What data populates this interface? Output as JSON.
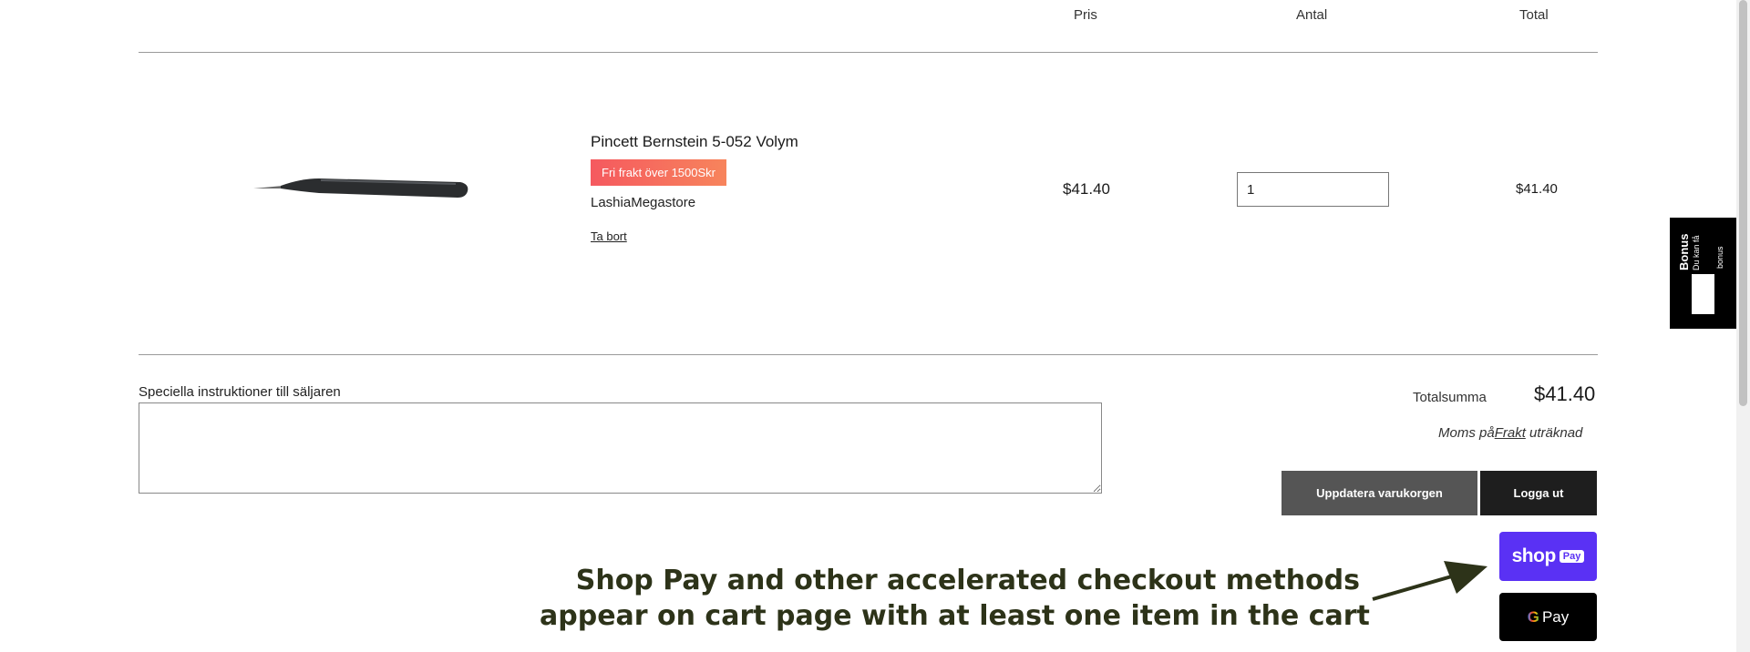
{
  "table_headers": {
    "price": "Pris",
    "quantity": "Antal",
    "total": "Total"
  },
  "item": {
    "title": "Pincett Bernstein 5-052 Volym",
    "promo_badge": "Fri frakt över 1500Skr",
    "vendor": "LashiaMegastore",
    "remove_label": "Ta bort",
    "unit_price": "$41.40",
    "quantity": "1",
    "line_total": "$41.40"
  },
  "notes": {
    "label": "Speciella instruktioner till säljaren"
  },
  "summary": {
    "subtotal_label": "Totalsumma",
    "subtotal_value": "$41.40",
    "tax_prefix": "Moms på",
    "tax_link": "Frakt",
    "tax_suffix": " uträknad"
  },
  "buttons": {
    "update": "Uppdatera varukorgen",
    "checkout": "Logga ut"
  },
  "express": {
    "shoppay_word": "shop",
    "shoppay_badge": "Pay",
    "gpay_g": "G",
    "gpay_label": "Pay"
  },
  "annotation": {
    "line1": "Shop Pay and other accelerated checkout methods",
    "line2": "appear on cart page with at least one item in the cart"
  },
  "bonus": {
    "title": "Bonus",
    "subtitle": "Du kan få",
    "subtitle2": "bonus"
  },
  "colors": {
    "shoppay": "#5a31f4",
    "badge_start": "#f5595f",
    "badge_end": "#f7845c",
    "annotation": "#2d3319"
  }
}
